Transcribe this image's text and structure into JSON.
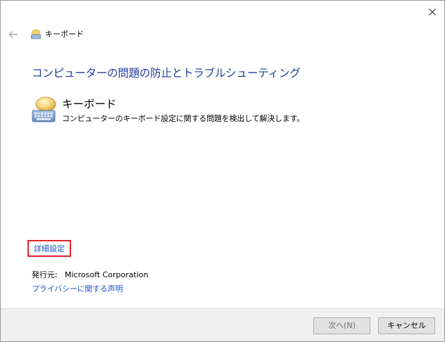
{
  "window": {
    "title": "キーボード",
    "close_icon": "close-icon",
    "back_icon": "back-arrow-icon"
  },
  "main": {
    "heading": "コンピューターの問題の防止とトラブルシューティング",
    "troubleshooter": {
      "icon": "keyboard-icon",
      "title": "キーボード",
      "description": "コンピューターのキーボード設定に関する問題を検出して解決します。"
    },
    "advanced_link": "詳細設定",
    "publisher_label": "発行元:",
    "publisher_value": "Microsoft Corporation",
    "privacy_link": "プライバシーに関する声明"
  },
  "footer": {
    "next_label": "次へ(N)",
    "cancel_label": "キャンセル"
  },
  "colors": {
    "heading": "#1e3c9c",
    "link": "#1e56c4",
    "highlight_border": "#e0232b",
    "footer_bg": "#f0f0f0"
  }
}
